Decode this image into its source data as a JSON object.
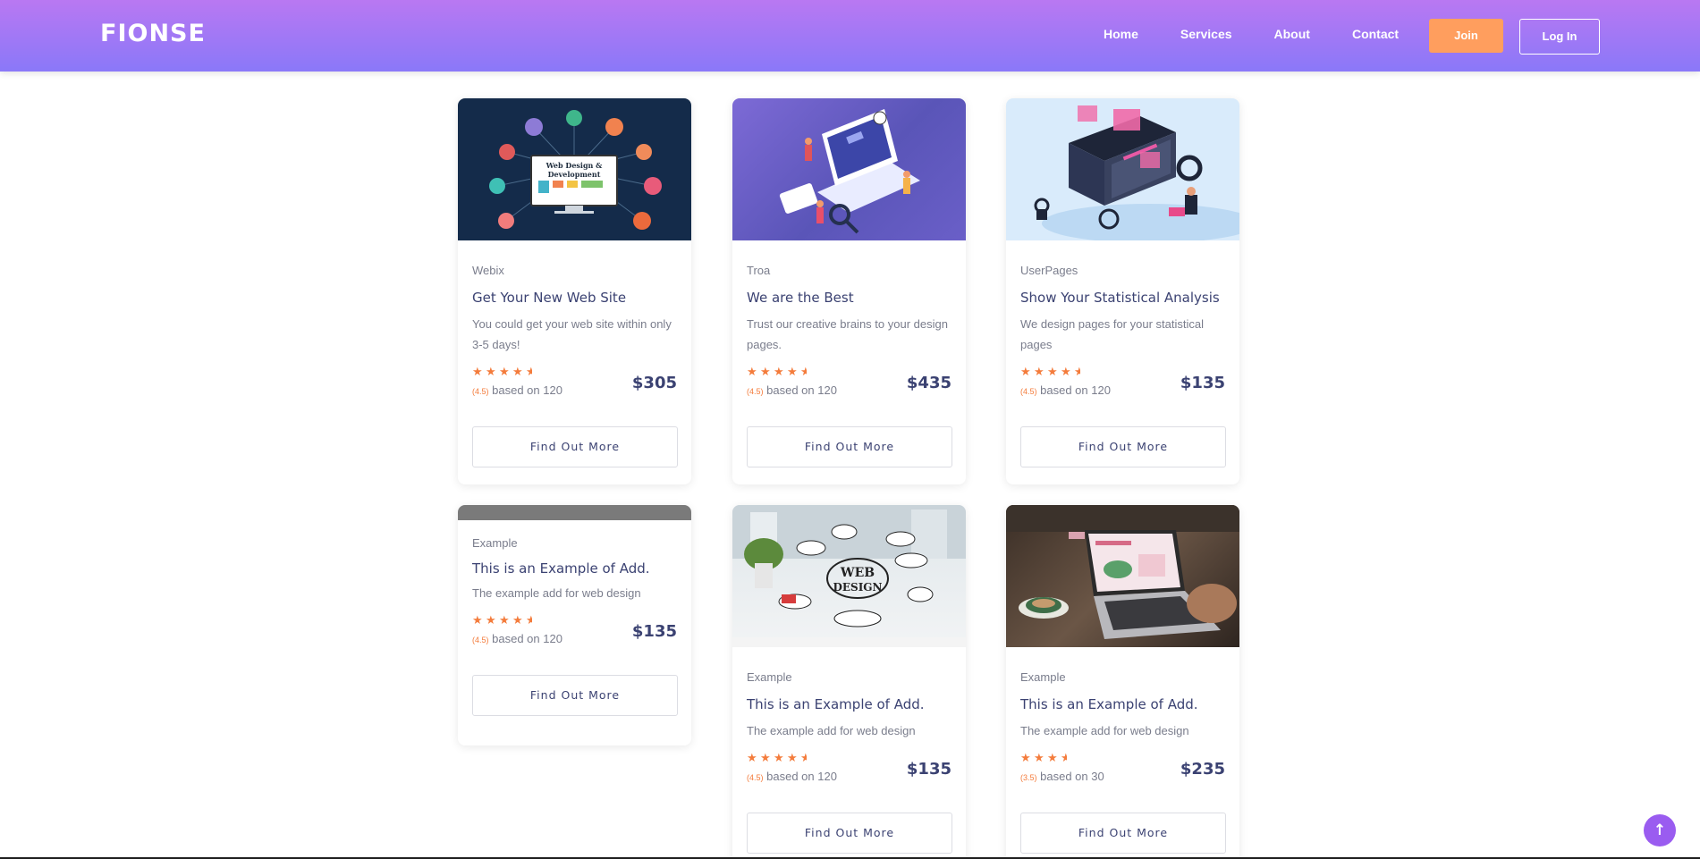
{
  "header": {
    "brand": "FIONSE",
    "nav": [
      "Home",
      "Services",
      "About",
      "Contact"
    ],
    "join_label": "Join",
    "login_label": "Log In",
    "accent": "#9a78f6",
    "join_color": "#ff9e5e"
  },
  "cards": [
    {
      "category": "Webix",
      "title": "Get Your New Web Site",
      "description": "You could get your web site within only 3-5 days!",
      "rating": "(4.5)",
      "based": "based on 120",
      "price": "$305",
      "button": "Find Out More",
      "stars": 4.5,
      "image_icon": "web-design-network-illustration"
    },
    {
      "category": "Troa",
      "title": "We are the Best",
      "description": "Trust our creative brains to your design pages.",
      "rating": "(4.5)",
      "based": "based on 120",
      "price": "$435",
      "button": "Find Out More",
      "stars": 4.5,
      "image_icon": "isometric-laptop-team-illustration"
    },
    {
      "category": "UserPages",
      "title": "Show Your Statistical Analysis",
      "description": "We design pages for your statistical pages",
      "rating": "(4.5)",
      "based": "based on 120",
      "price": "$135",
      "button": "Find Out More",
      "stars": 4.5,
      "image_icon": "isometric-analytics-illustration"
    },
    {
      "category": "Example",
      "title": "This is an Example of Add.",
      "description": "The example add for web design",
      "rating": "(4.5)",
      "based": "based on 120",
      "price": "$135",
      "button": "Find Out More",
      "stars": 4.5,
      "image_icon": "empty-image-bar"
    },
    {
      "category": "Example",
      "title": "This is an Example of Add.",
      "description": "The example add for web design",
      "rating": "(4.5)",
      "based": "based on 120",
      "price": "$135",
      "button": "Find Out More",
      "stars": 4.5,
      "image_icon": "web-design-sketch-photo"
    },
    {
      "category": "Example",
      "title": "This is an Example of Add.",
      "description": "The example add for web design",
      "rating": "(3.5)",
      "based": "based on 30",
      "price": "$235",
      "button": "Find Out More",
      "stars": 3.5,
      "image_icon": "laptop-coffee-photo"
    }
  ],
  "back_to_top_icon": "arrow-up-icon"
}
